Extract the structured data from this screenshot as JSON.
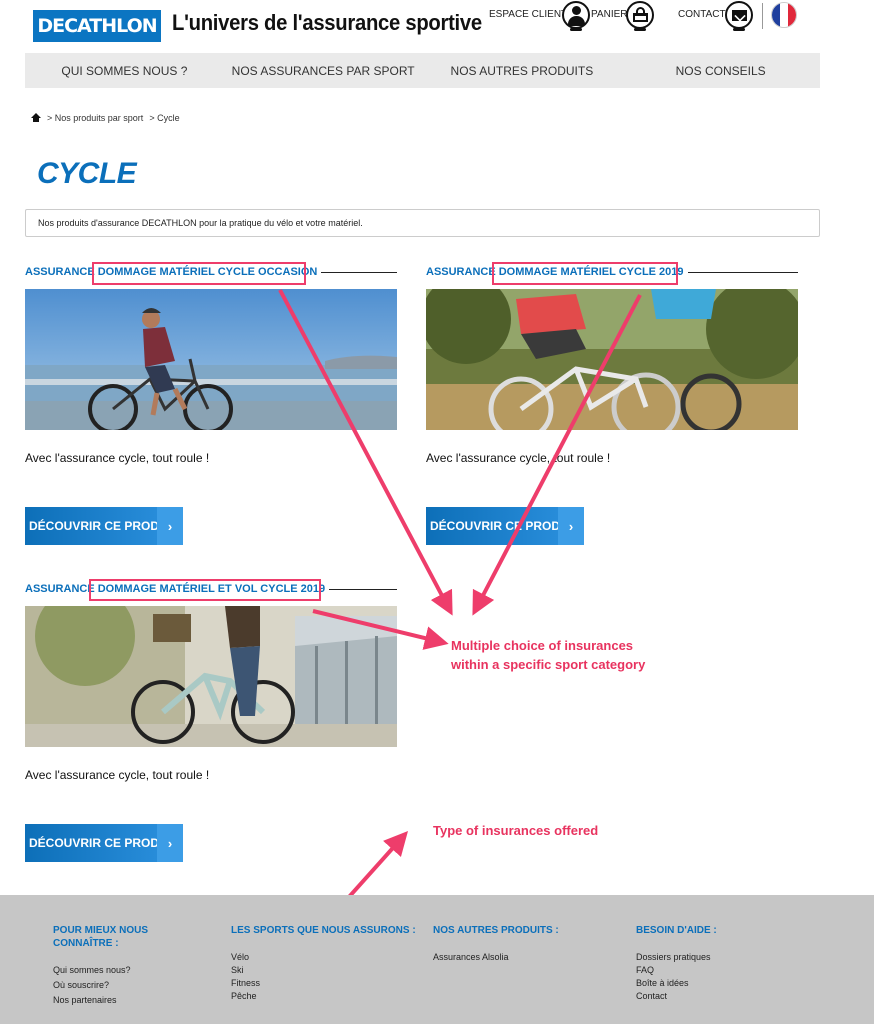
{
  "header": {
    "logo": "DECATHLON",
    "title": "L'univers de l'assurance sportive",
    "espace_client": "ESPACE CLIENT",
    "panier": "PANIER",
    "contact": "CONTACT"
  },
  "nav": {
    "items": [
      {
        "label": "QUI SOMMES NOUS ?"
      },
      {
        "label": "NOS ASSURANCES PAR SPORT"
      },
      {
        "label": "NOS AUTRES PRODUITS"
      },
      {
        "label": "NOS CONSEILS"
      }
    ]
  },
  "breadcrumb": {
    "items": [
      "> Nos produits par sport",
      "> Cycle"
    ]
  },
  "page": {
    "title": "CYCLE",
    "intro": "Nos produits d'assurance DECATHLON pour la pratique du vélo et votre matériel."
  },
  "products": [
    {
      "prefix": "ASSURANCE ",
      "highlight": "DOMMAGE MATÉRIEL CYCLE OCCASION",
      "desc": "Avec l'assurance cycle, tout roule !",
      "button": "DÉCOUVRIR CE PRODUIT"
    },
    {
      "prefix": "ASSURANCE ",
      "highlight": "DOMMAGE MATÉRIEL CYCLE 2019",
      "desc": "Avec l'assurance cycle, tout roule !",
      "button": "DÉCOUVRIR CE PRODUIT"
    },
    {
      "prefix": "ASSURANCE ",
      "highlight": "DOMMAGE MATÉRIEL ET VOL CYCLE 2019",
      "desc": "Avec l'assurance cycle, tout roule !",
      "button": "DÉCOUVRIR CE PRODUIT"
    }
  ],
  "annotations": {
    "multiple_line1": "Multiple choice of insurances",
    "multiple_line2": "within a specific sport category",
    "types": "Type of insurances offered"
  },
  "footer": {
    "col1": {
      "heading_line1": "POUR MIEUX NOUS",
      "heading_line2": "CONNAÎTRE :",
      "links": [
        "Qui sommes nous?",
        "Où souscrire?",
        "Nos partenaires"
      ]
    },
    "col2": {
      "heading": "LES SPORTS QUE NOUS ASSURONS :",
      "links": [
        "Vélo",
        "Ski",
        "Fitness",
        "Pêche"
      ]
    },
    "col3": {
      "heading": "NOS AUTRES PRODUITS :",
      "links": [
        "Assurances Alsolia"
      ]
    },
    "col4": {
      "heading": "BESOIN D'AIDE :",
      "links": [
        "Dossiers pratiques",
        "FAQ",
        "Boîte à idées",
        "Contact"
      ]
    }
  },
  "colors": {
    "brand_blue": "#0b75c2",
    "annotation_pink": "#ee3d6b"
  }
}
